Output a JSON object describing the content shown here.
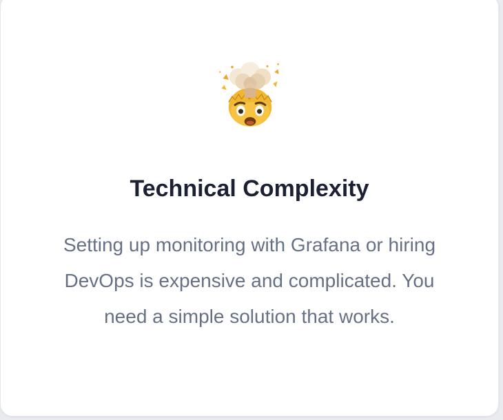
{
  "card": {
    "icon": "exploding-head-emoji",
    "title": "Technical Complexity",
    "description": "Setting up monitoring with Grafana or hiring DevOps is expensive and complicated. You need a simple solution that works."
  },
  "colors": {
    "card_background": "#ffffff",
    "title": "#1b2133",
    "description": "#667085",
    "border": "#e4e7ec"
  }
}
